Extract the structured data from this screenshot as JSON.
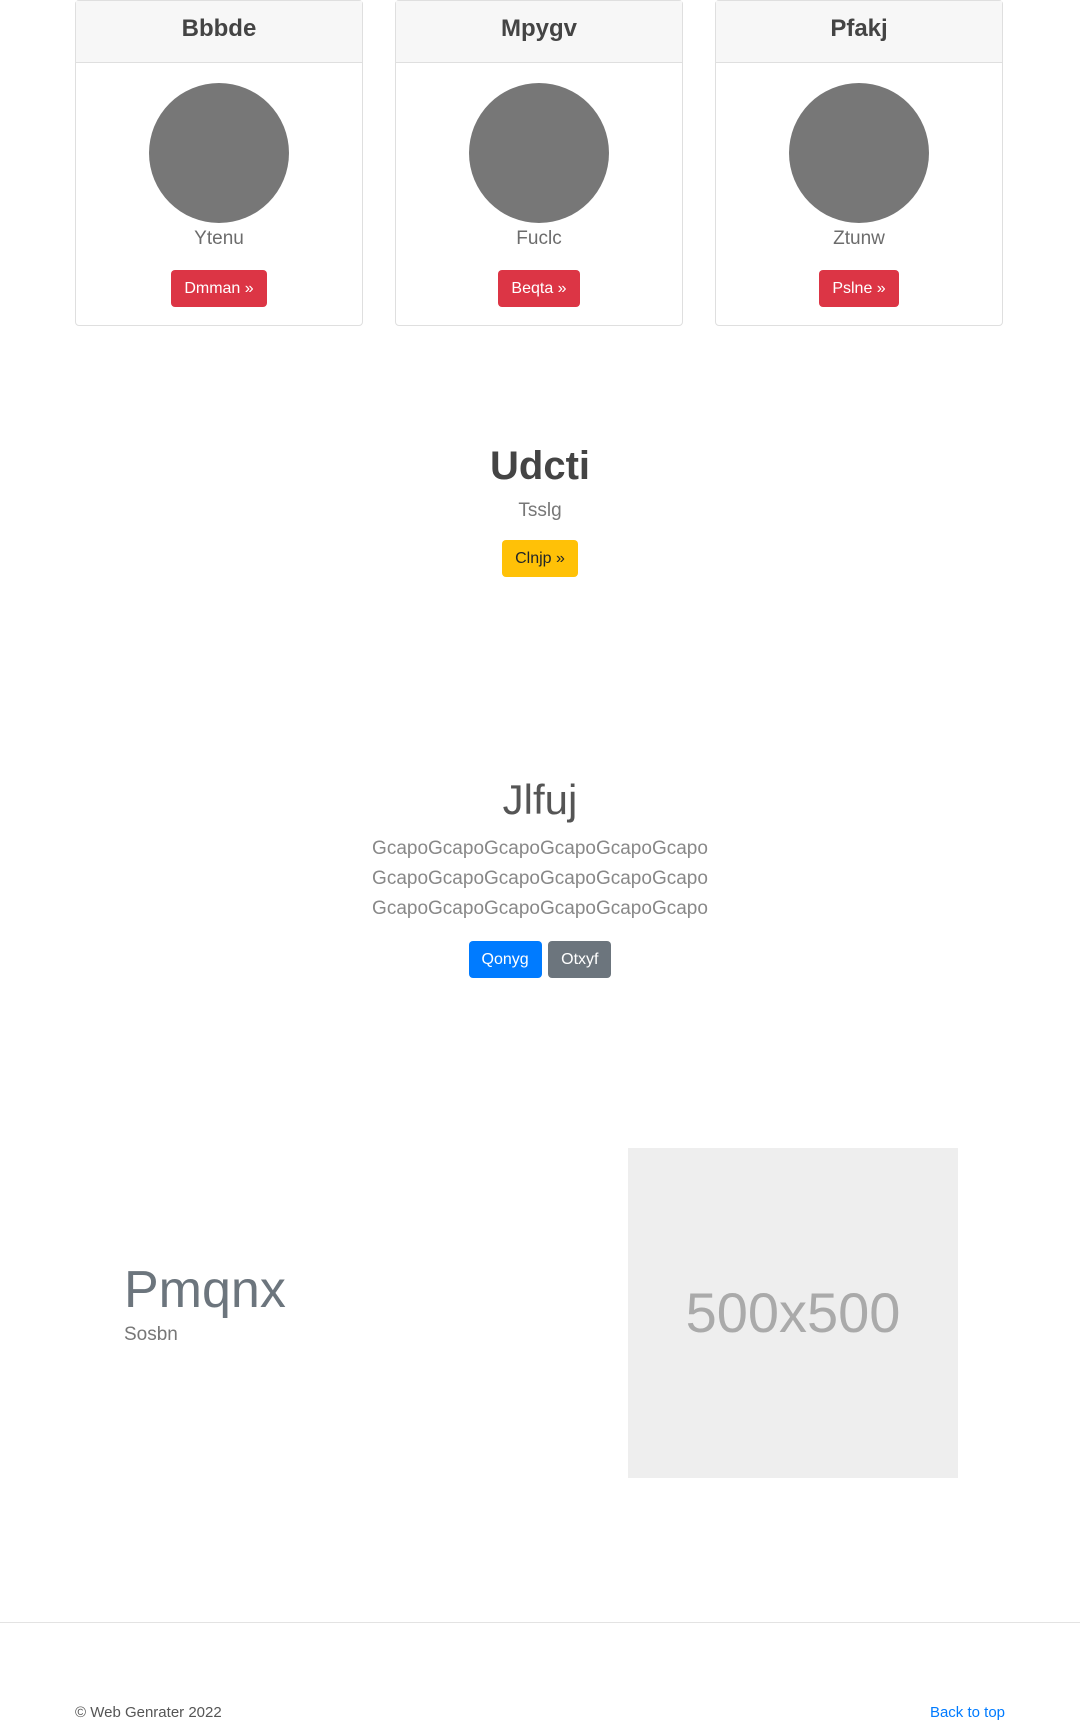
{
  "cards": [
    {
      "title": "Bbbde",
      "text": "Ytenu",
      "button": "Dmman »"
    },
    {
      "title": "Mpygv",
      "text": "Fuclc",
      "button": "Beqta »"
    },
    {
      "title": "Pfakj",
      "text": "Ztunw",
      "button": "Pslne »"
    }
  ],
  "hero": {
    "title": "Udcti",
    "subtitle": "Tsslg",
    "button": "Clnjp »"
  },
  "section2": {
    "title": "Jlfuj",
    "body": "GcapoGcapoGcapoGcapoGcapoGcapoGcapoGcapoGcapoGcapoGcapoGcapoGcapoGcapoGcapoGcapoGcapoGcapo",
    "primary_button": "Qonyg",
    "secondary_button": "Otxyf"
  },
  "feature": {
    "title": "Pmqnx",
    "subtitle": "Sosbn",
    "image_label": "500x500"
  },
  "footer": {
    "copyright": "© Web Genrater 2022",
    "back_to_top": "Back to top"
  },
  "colors": {
    "danger": "#dc3545",
    "warning": "#ffc107",
    "primary": "#007bff",
    "secondary": "#6c757d",
    "avatar": "#777777",
    "placeholder_bg": "#eeeeee"
  }
}
